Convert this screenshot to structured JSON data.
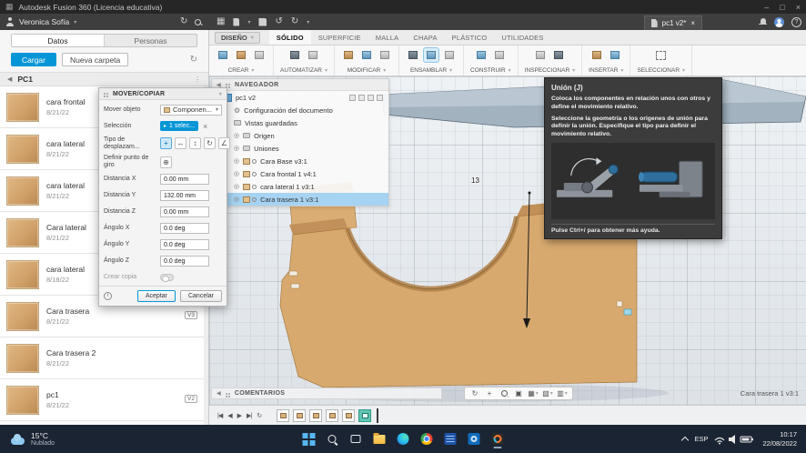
{
  "icons": {
    "grid": "▦",
    "caret_down": "▾",
    "tree_expand": "▷",
    "back": "◀",
    "overflow": "⋮",
    "close": "×",
    "minimize": "–",
    "maximize": "□",
    "undo": "↺",
    "redo": "↻",
    "gear": "⚙",
    "eye": "◎",
    "help": "?",
    "info": "i",
    "move_free": "+",
    "move_h": "↔",
    "move_v": "↕",
    "rotate": "↻",
    "angle": "∠",
    "pivot": "⊕",
    "skip_start": "|◀",
    "step_back": "◀",
    "play": "▶",
    "skip_end": "▶|",
    "loop": "↻",
    "orbit": "↻",
    "pan": "+",
    "fit": "▣",
    "grid_settings": "▦",
    "display": "▧",
    "viewports": "▥",
    "chip_cursor": "▸"
  },
  "titlebar": {
    "title": "Autodesk Fusion 360 (Licencia educativa)"
  },
  "appbar": {
    "user": "Veronica Sofía",
    "doc_tab": "pc1 v2*"
  },
  "data_panel": {
    "tab_datos": "Datos",
    "tab_personas": "Personas",
    "upload_button": "Cargar",
    "new_folder_button": "Nueva carpeta",
    "folder_name": "PC1",
    "items": [
      {
        "name": "cara frontal",
        "date": "8/21/22"
      },
      {
        "name": "cara lateral",
        "date": "8/21/22"
      },
      {
        "name": "cara lateral",
        "date": "8/21/22"
      },
      {
        "name": "Cara lateral",
        "date": "8/21/22"
      },
      {
        "name": "cara lateral",
        "date": "8/18/22"
      },
      {
        "name": "Cara trasera",
        "date": "8/21/22",
        "badge": "V3"
      },
      {
        "name": "Cara trasera 2",
        "date": "8/21/22"
      },
      {
        "name": "pc1",
        "date": "8/21/22",
        "badge": "V2"
      }
    ]
  },
  "toolbar": {
    "workspace": "DISEÑO",
    "tabs": [
      "SÓLIDO",
      "SUPERFICIE",
      "MALLA",
      "CHAPA",
      "PLÁSTICO",
      "UTILIDADES"
    ],
    "groups": [
      "CREAR",
      "AUTOMATIZAR",
      "MODIFICAR",
      "ENSAMBLAR",
      "CONSTRUIR",
      "INSPECCIONAR",
      "INSERTAR",
      "SELECCIONAR"
    ]
  },
  "navigator": {
    "title": "NAVEGADOR",
    "root": "pc1 v2",
    "items": [
      "Configuración del documento",
      "Vistas guardadas",
      "Origen",
      "Uniones",
      "Cara Base v3:1",
      "Cara frontal 1 v4:1",
      "cara lateral 1 v3:1",
      "Cara trasera 1 v3:1"
    ]
  },
  "dialog": {
    "title": "MOVER/COPIAR",
    "move_object_label": "Mover objeto",
    "move_object_value": "Componen...",
    "selection_label": "Selección",
    "selection_value": "1 selec...",
    "move_type_label": "Tipo de desplazam...",
    "pivot_label": "Definir punto de giro",
    "fields": [
      {
        "label": "Distancia X",
        "value": "0.00 mm"
      },
      {
        "label": "Distancia Y",
        "value": "132.00 mm"
      },
      {
        "label": "Distancia Z",
        "value": "0.00 mm"
      },
      {
        "label": "Ángulo X",
        "value": "0.0 deg"
      },
      {
        "label": "Ángulo Y",
        "value": "0.0 deg"
      },
      {
        "label": "Ángulo Z",
        "value": "0.0 deg"
      }
    ],
    "create_copy_label": "Crear copia",
    "ok_button": "Aceptar",
    "cancel_button": "Cancelar"
  },
  "tooltip": {
    "title": "Unión (J)",
    "body1": "Coloca los componentes en relación unos con otros y define el movimiento relativo.",
    "body2": "Seleccione la geometría o los orígenes de unión para definir la unión. Especifique el tipo para definir el movimiento relativo.",
    "footer": "Pulse Ctrl+/ para obtener más ayuda."
  },
  "canvas": {
    "dimension_label": "13",
    "selected_component": "Cara trasera 1 v3:1"
  },
  "comments_bar": {
    "title": "COMENTARIOS"
  },
  "taskbar": {
    "temperature": "15°C",
    "weather": "Nublado",
    "language": "ESP",
    "time": "10:17",
    "date": "22/08/2022"
  }
}
